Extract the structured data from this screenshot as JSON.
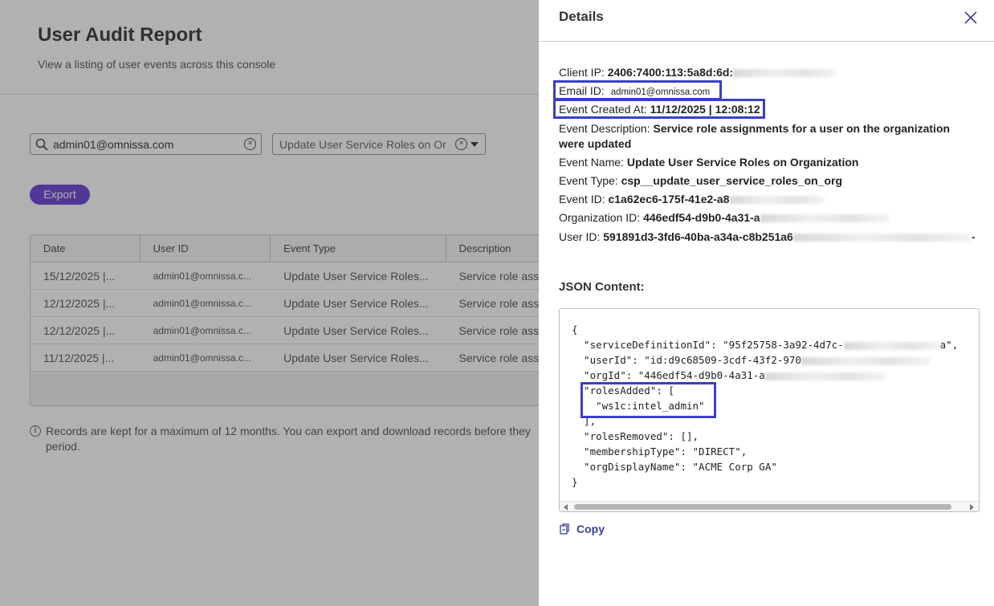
{
  "page": {
    "title": "User Audit Report",
    "subtitle": "View a listing of user events across this console"
  },
  "filters": {
    "search_value": "admin01@omnissa.com",
    "event_type_value": "Update User Service Roles on Or"
  },
  "export_label": "Export",
  "table": {
    "headers": [
      "Date",
      "User ID",
      "Event Type",
      "Description"
    ],
    "rows": [
      [
        "15/12/2025 |...",
        "admin01@omnissa.c...",
        "Update User Service Roles...",
        "Service role ass"
      ],
      [
        "12/12/2025 |...",
        "admin01@omnissa.c...",
        "Update User Service Roles...",
        "Service role ass"
      ],
      [
        "12/12/2025 |...",
        "admin01@omnissa.c...",
        "Update User Service Roles...",
        "Service role ass"
      ],
      [
        "11/12/2025 |...",
        "admin01@omnissa.c...",
        "Update User Service Roles...",
        "Service role ass"
      ]
    ]
  },
  "info_note": "Records are kept for a maximum of 12 months. You can export and download records before they period.",
  "details": {
    "title": "Details",
    "client_ip_label": "Client IP:",
    "client_ip_value": "2406:7400:113:5a8d:6d:",
    "email_label": "Email ID:",
    "email_value": "admin01@omnissa.com",
    "created_label": "Event Created At:",
    "created_value": "11/12/2025 | 12:08:12",
    "description_label": "Event Description:",
    "description_value": "Service role assignments for a user on the organization were updated",
    "name_label": "Event Name:",
    "name_value": "Update User Service Roles on Organization",
    "type_label": "Event Type:",
    "type_value": "csp__update_user_service_roles_on_org",
    "event_id_label": "Event ID:",
    "event_id_value": "c1a62ec6-175f-41e2-a8",
    "org_id_label": "Organization ID:",
    "org_id_value": "446edf54-d9b0-4a31-a",
    "user_id_label": "User ID:",
    "user_id_value": "591891d3-3fd6-40ba-a34a-c8b251a6",
    "user_id_tail": "-",
    "json_title": "JSON Content:",
    "json_lines": [
      "{",
      "  \"serviceDefinitionId\": \"95f25758-3a92-4d7c-",
      "  \"userId\": \"id:d9c68509-3cdf-43f2-970",
      "  \"orgId\": \"446edf54-d9b0-4a31-a",
      "  \"rolesAdded\": [",
      "    \"ws1c:intel_admin\"",
      "  ],",
      "  \"rolesRemoved\": [],",
      "  \"membershipType\": \"DIRECT\",",
      "  \"orgDisplayName\": \"ACME Corp GA\"",
      "}"
    ],
    "json_line1_tail": "a\",",
    "copy_label": "Copy"
  }
}
